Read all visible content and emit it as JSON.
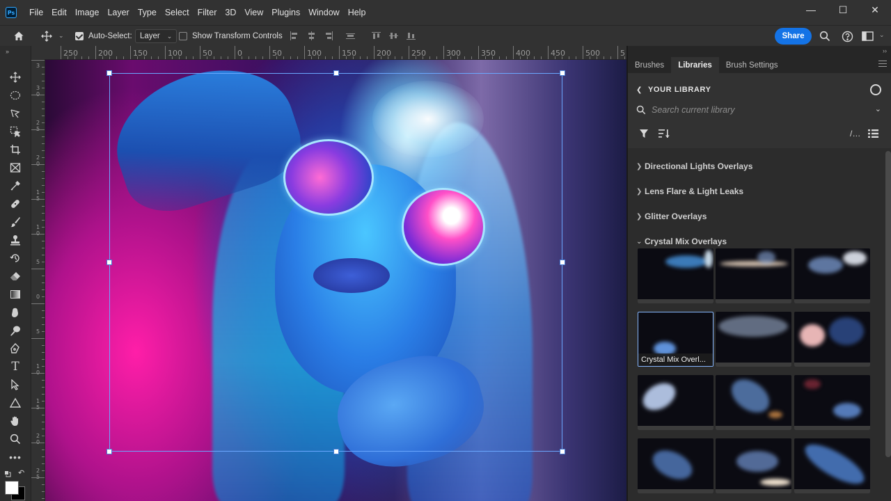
{
  "app": {
    "logo": "Ps"
  },
  "menu": [
    "File",
    "Edit",
    "Image",
    "Layer",
    "Type",
    "Select",
    "Filter",
    "3D",
    "View",
    "Plugins",
    "Window",
    "Help"
  ],
  "window_controls": {
    "minimize": "—",
    "maximize": "☐",
    "close": "✕"
  },
  "options_bar": {
    "auto_select_label": "Auto-Select:",
    "auto_select_checked": true,
    "auto_select_target": "Layer",
    "show_transform_label": "Show Transform Controls",
    "show_transform_checked": false,
    "share_label": "Share"
  },
  "ruler": {
    "top_labels": [
      "250",
      "200",
      "150",
      "100",
      "50",
      "0",
      "50",
      "100",
      "150",
      "200",
      "250",
      "300",
      "350",
      "400",
      "450",
      "500",
      "5"
    ],
    "left_labels": [
      "3",
      "3 0",
      "2 5",
      "2 0",
      "1 5",
      "1 0",
      "5",
      "0",
      "5",
      "1 0",
      "1 5",
      "2 0",
      "2 5"
    ]
  },
  "tools": [
    "move-icon",
    "elliptical-marquee-icon",
    "lasso-icon",
    "object-select-icon",
    "crop-icon",
    "frame-icon",
    "eyedropper-icon",
    "healing-brush-icon",
    "brush-icon",
    "clone-stamp-icon",
    "history-brush-icon",
    "eraser-icon",
    "gradient-icon",
    "smudge-icon",
    "dodge-icon",
    "pen-icon",
    "type-icon",
    "path-select-icon",
    "shape-icon",
    "hand-icon",
    "zoom-icon",
    "more-tools-icon"
  ],
  "colors": {
    "accent": "#1473e6",
    "panel_bg": "#323232",
    "foreground": "#ffffff",
    "background": "#000000"
  },
  "panel": {
    "tabs": [
      {
        "label": "Brushes",
        "active": false
      },
      {
        "label": "Libraries",
        "active": true
      },
      {
        "label": "Brush Settings",
        "active": false
      }
    ],
    "library_title": "YOUR LIBRARY",
    "search_placeholder": "Search current library",
    "groups": [
      {
        "label": "Directional Lights Overlays",
        "expanded": false
      },
      {
        "label": "Lens Flare & Light Leaks",
        "expanded": false
      },
      {
        "label": "Glitter Overlays",
        "expanded": false
      },
      {
        "label": "Crystal Mix Overlays",
        "expanded": true
      }
    ],
    "selected_asset_caption": "Crystal Mix Overl..."
  }
}
